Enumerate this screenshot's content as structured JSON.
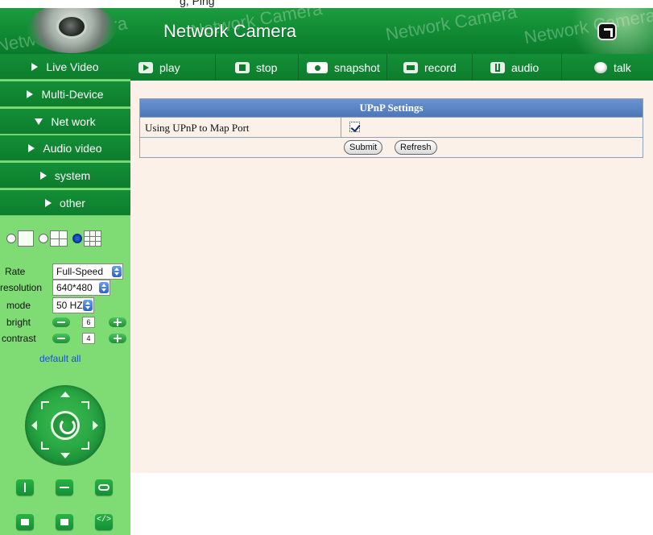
{
  "top_strip_text": "g, Ping",
  "header": {
    "title": "Network Camera",
    "watermark": "Network Camera"
  },
  "sidebar": {
    "items": [
      {
        "label": "Live Video",
        "expanded": false
      },
      {
        "label": "Multi-Device",
        "expanded": false
      },
      {
        "label": "Net work",
        "expanded": true
      },
      {
        "label": "Audio video",
        "expanded": false
      },
      {
        "label": "system",
        "expanded": false
      },
      {
        "label": "other",
        "expanded": false
      }
    ],
    "layout_selected": "9-split",
    "controls": {
      "rate_label": "Rate",
      "rate_value": "Full-Speed",
      "resolution_label": "resolution",
      "resolution_value": "640*480",
      "mode_label": "mode",
      "mode_value": "50 HZ",
      "bright_label": "bright",
      "bright_value": "6",
      "contrast_label": "contrast",
      "contrast_value": "4",
      "default_all": "default all"
    }
  },
  "toolbar": {
    "play": "play",
    "stop": "stop",
    "snapshot": "snapshot",
    "record": "record",
    "audio": "audio",
    "talk": "talk"
  },
  "upnp": {
    "heading": "UPnP Settings",
    "row_label": "Using UPnP to Map Port",
    "checked": true,
    "submit": "Submit",
    "refresh": "Refresh"
  },
  "colors": {
    "accent_green": "#0d7d2d",
    "sidebar_bg": "#7fdc74",
    "panel_header": "#4c77b8",
    "content_bg": "#fbf1e8"
  }
}
